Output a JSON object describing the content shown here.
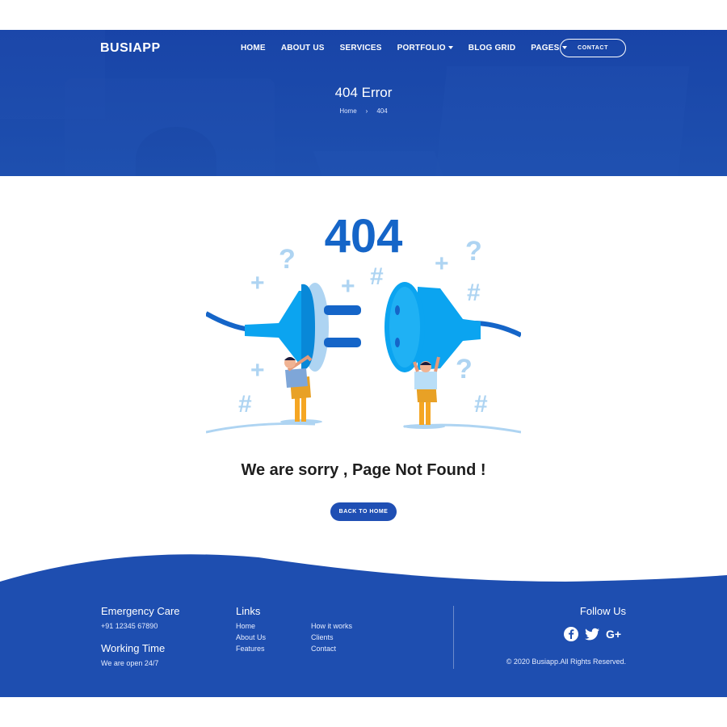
{
  "header": {
    "brand": "BUSIAPP",
    "nav": [
      "HOME",
      "ABOUT US",
      "SERVICES",
      "PORTFOLIO",
      "BLOG GRID",
      "PAGES"
    ],
    "contact_label": "CONTACT"
  },
  "hero": {
    "title": "404 Error",
    "breadcrumb_home": "Home",
    "breadcrumb_sep": "›",
    "breadcrumb_current": "404"
  },
  "main": {
    "error_code": "404",
    "message": "We are sorry , Page Not Found !",
    "back_label": "BACK TO HOME"
  },
  "footer": {
    "emergency_title": "Emergency Care",
    "emergency_phone": "+91 12345 67890",
    "working_title": "Working Time",
    "working_text": "We are open 24/7",
    "links_title": "Links",
    "links_col1": [
      "Home",
      "About Us",
      "Features"
    ],
    "links_col2": [
      "How it works",
      "Clients",
      "Contact"
    ],
    "follow_title": "Follow Us",
    "social_icons": [
      "facebook-icon",
      "twitter-icon",
      "google-plus-icon"
    ],
    "copyright": "© 2020 Busiapp.All Rights Reserved."
  },
  "colors": {
    "brand_blue": "#1e4eb0",
    "plug_blue": "#0ba4f0",
    "light_blue": "#aed4f2"
  }
}
